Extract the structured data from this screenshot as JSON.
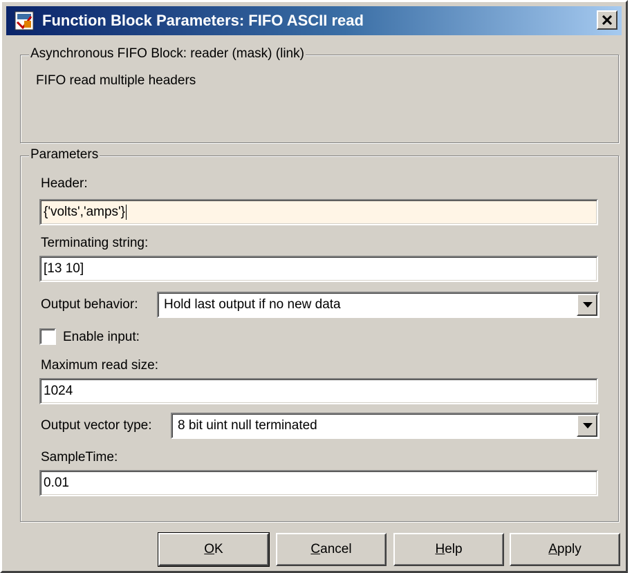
{
  "window": {
    "title": "Function Block Parameters: FIFO ASCII read",
    "icon": "simulink-block-icon",
    "close_icon": "close-icon"
  },
  "description": {
    "legend": "Asynchronous FIFO Block: reader (mask) (link)",
    "text": "FIFO read multiple headers"
  },
  "parameters": {
    "legend": "Parameters",
    "header_label": "Header:",
    "header_value": "{'volts','amps'}",
    "terminating_label": "Terminating string:",
    "terminating_value": "[13 10]",
    "output_behavior_label": "Output behavior:",
    "output_behavior_value": "Hold last output if no new data",
    "enable_input_label": "Enable input:",
    "enable_input_checked": false,
    "max_read_label": "Maximum read size:",
    "max_read_value": "1024",
    "output_vector_label": "Output vector type:",
    "output_vector_value": "8 bit uint null terminated",
    "sample_time_label": "SampleTime:",
    "sample_time_value": "0.01"
  },
  "buttons": {
    "ok": {
      "mnemonic": "O",
      "rest": "K"
    },
    "cancel": {
      "mnemonic": "C",
      "rest": "ancel"
    },
    "help": {
      "mnemonic": "H",
      "rest": "elp"
    },
    "apply": {
      "mnemonic": "A",
      "rest": "pply"
    }
  },
  "colors": {
    "title_start": "#0a246a",
    "title_end": "#a6caf0",
    "face": "#d4d0c8",
    "focused_field": "#fff5e6"
  }
}
